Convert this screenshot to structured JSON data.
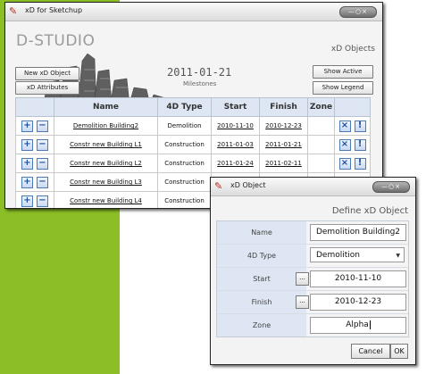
{
  "main_window": {
    "title": "xD for Sketchup",
    "window_controls": "—○×",
    "brand": "D-STUDIO",
    "date": "2011-01-21",
    "subtitle": "Milestones",
    "heading_right": "xD Objects",
    "buttons": {
      "new_object": "New xD Object",
      "attributes": "xD Attributes",
      "show_active": "Show Active",
      "show_legend": "Show Legend"
    },
    "table": {
      "headers": [
        "Name",
        "4D Type",
        "Start",
        "Finish",
        "Zone"
      ],
      "rows": [
        {
          "name": "Demolition Building2",
          "type": "Demolition",
          "start": "2010-11-10",
          "finish": "2010-12-23",
          "zone": ""
        },
        {
          "name": "Constr new Building L1",
          "type": "Construction",
          "start": "2011-01-03",
          "finish": "2011-01-21",
          "zone": ""
        },
        {
          "name": "Constr new Building L2",
          "type": "Construction",
          "start": "2011-01-24",
          "finish": "2011-02-11",
          "zone": ""
        },
        {
          "name": "Constr new Building L3",
          "type": "Construction",
          "start": "",
          "finish": "",
          "zone": ""
        },
        {
          "name": "Constr new Building L4",
          "type": "Construction",
          "start": "",
          "finish": "",
          "zone": ""
        }
      ]
    }
  },
  "dialog": {
    "title": "xD Object",
    "window_controls": "—○×",
    "heading": "Define xD Object",
    "fields": {
      "name": {
        "label": "Name",
        "value": "Demolition Building2"
      },
      "type": {
        "label": "4D Type",
        "value": "Demolition"
      },
      "start": {
        "label": "Start",
        "value": "2010-11-10"
      },
      "finish": {
        "label": "Finish",
        "value": "2010-12-23"
      },
      "zone": {
        "label": "Zone",
        "value": "Alpha"
      }
    },
    "dots_label": "...",
    "cancel": "Cancel",
    "ok": "OK"
  },
  "icons": {
    "app": "sketchup-logo-icon",
    "add": "plus-icon",
    "remove": "minus-icon",
    "delete": "close-box-icon",
    "info": "exclamation-icon",
    "dropdown": "chevron-down-icon"
  },
  "colors": {
    "side_green": "#8cbf26",
    "header_blue": "#dde6f2",
    "icon_blue": "#1e4f9a"
  }
}
